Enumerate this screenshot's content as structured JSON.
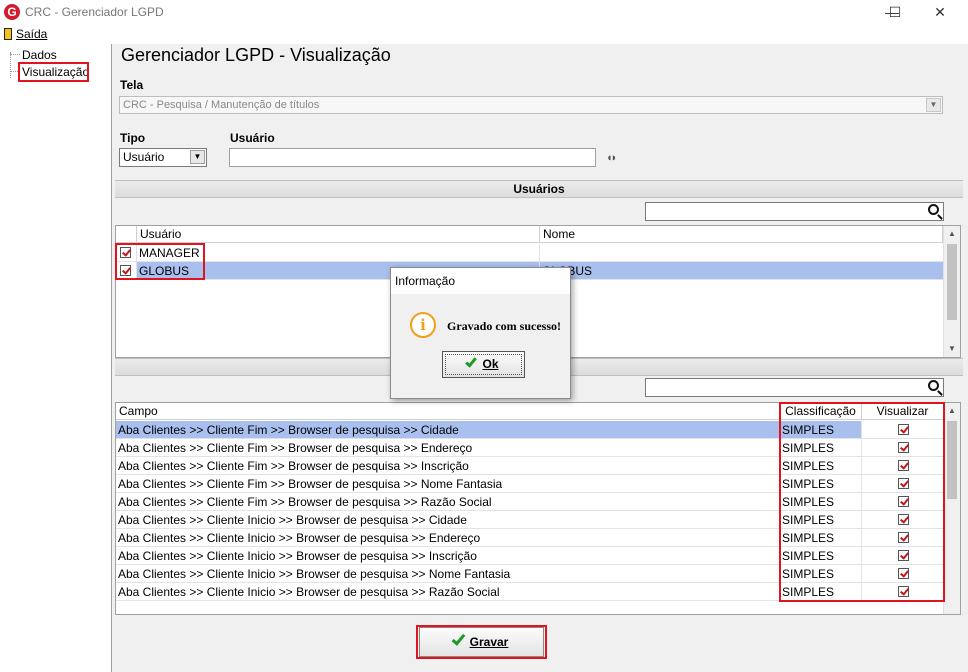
{
  "window": {
    "title": "CRC - Gerenciador LGPD",
    "minimize": "—",
    "maximize": "☐",
    "close": "✕"
  },
  "menu": {
    "exit_label": "Saída"
  },
  "tree": {
    "items": [
      {
        "label": "Dados"
      },
      {
        "label": "Visualização"
      }
    ]
  },
  "page": {
    "title": "Gerenciador LGPD - Visualização"
  },
  "form": {
    "tela_label": "Tela",
    "tela_value": "CRC - Pesquisa / Manutenção de títulos",
    "tipo_label": "Tipo",
    "tipo_value": "Usuário",
    "usuario_label": "Usuário",
    "usuario_value": ""
  },
  "users_section": {
    "title": "Usuários",
    "search_value": "",
    "columns": [
      "Usuário",
      "Nome"
    ],
    "rows": [
      {
        "checked": true,
        "usuario": "MANAGER",
        "nome": ""
      },
      {
        "checked": true,
        "usuario": "GLOBUS",
        "nome": "GLOBUS"
      }
    ]
  },
  "fields_section": {
    "title": "Campo",
    "search_value": "",
    "columns": [
      "Campo",
      "Classificação",
      "Visualizar"
    ],
    "rows": [
      {
        "campo": "Aba Clientes >> Cliente Fim >> Browser de pesquisa >> Cidade",
        "classificacao": "SIMPLES",
        "visualizar": true
      },
      {
        "campo": "Aba Clientes >> Cliente Fim >> Browser de pesquisa >> Endereço",
        "classificacao": "SIMPLES",
        "visualizar": true
      },
      {
        "campo": "Aba Clientes >> Cliente Fim >> Browser de pesquisa >> Inscrição",
        "classificacao": "SIMPLES",
        "visualizar": true
      },
      {
        "campo": "Aba Clientes >> Cliente Fim >> Browser de pesquisa >> Nome Fantasia",
        "classificacao": "SIMPLES",
        "visualizar": true
      },
      {
        "campo": "Aba Clientes >> Cliente Fim >> Browser de pesquisa >> Razão Social",
        "classificacao": "SIMPLES",
        "visualizar": true
      },
      {
        "campo": "Aba Clientes >> Cliente Inicio >> Browser de pesquisa >> Cidade",
        "classificacao": "SIMPLES",
        "visualizar": true
      },
      {
        "campo": "Aba Clientes >> Cliente Inicio >> Browser de pesquisa >> Endereço",
        "classificacao": "SIMPLES",
        "visualizar": true
      },
      {
        "campo": "Aba Clientes >> Cliente Inicio >> Browser de pesquisa >> Inscrição",
        "classificacao": "SIMPLES",
        "visualizar": true
      },
      {
        "campo": "Aba Clientes >> Cliente Inicio >> Browser de pesquisa >> Nome Fantasia",
        "classificacao": "SIMPLES",
        "visualizar": true
      },
      {
        "campo": "Aba Clientes >> Cliente Inicio >> Browser de pesquisa >> Razão Social",
        "classificacao": "SIMPLES",
        "visualizar": true
      }
    ]
  },
  "buttons": {
    "gravar_label": "Gravar"
  },
  "dialog": {
    "title": "Informação",
    "message": "Gravado com sucesso!",
    "ok_label": "Ok"
  },
  "colors": {
    "highlight": "#e0141e",
    "selected_row": "#a9c0ee",
    "check": "#1e9a2a",
    "info": "#f0a018"
  }
}
